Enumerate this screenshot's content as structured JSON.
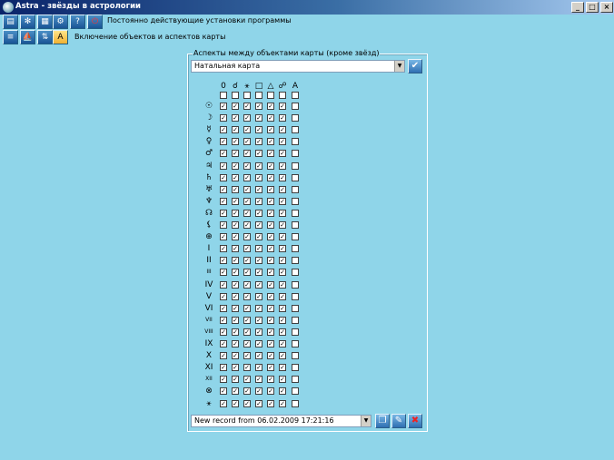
{
  "window": {
    "title": "Astra - звёзды в астрологии",
    "controls": [
      "_",
      "□",
      "×"
    ]
  },
  "toolbar": {
    "row1_label": "Постоянно действующие установки программы",
    "row2_label": "Включение объектов и аспектов карты",
    "row1_icons": [
      "document-icon",
      "asterisk-icon",
      "grid-icon",
      "gear-icon",
      "help-icon",
      "power-icon"
    ],
    "row2_icons": [
      "list-icon",
      "ship-icon",
      "compare-icon",
      "font-icon"
    ]
  },
  "aspects_panel": {
    "title": "Аспекты между объектами карты (кроме звёзд)",
    "chart_type": "Натальная карта",
    "record": "New record from 06.02.2009 17:21:16",
    "columns": [
      "0",
      "☌",
      "⚹",
      "□",
      "△",
      "☍",
      "A"
    ],
    "rows": [
      {
        "symbol": "☉",
        "checked": [
          true,
          true,
          true,
          true,
          true,
          true,
          false
        ]
      },
      {
        "symbol": "☽",
        "checked": [
          true,
          true,
          true,
          true,
          true,
          true,
          false
        ]
      },
      {
        "symbol": "☿",
        "checked": [
          true,
          true,
          true,
          true,
          true,
          true,
          false
        ]
      },
      {
        "symbol": "♀",
        "checked": [
          true,
          true,
          true,
          true,
          true,
          true,
          false
        ]
      },
      {
        "symbol": "♂",
        "checked": [
          true,
          true,
          true,
          true,
          true,
          true,
          false
        ]
      },
      {
        "symbol": "♃",
        "checked": [
          true,
          true,
          true,
          true,
          true,
          true,
          false
        ]
      },
      {
        "symbol": "♄",
        "checked": [
          true,
          true,
          true,
          true,
          true,
          true,
          false
        ]
      },
      {
        "symbol": "♅",
        "checked": [
          true,
          true,
          true,
          true,
          true,
          true,
          false
        ]
      },
      {
        "symbol": "♆",
        "checked": [
          true,
          true,
          true,
          true,
          true,
          true,
          false
        ]
      },
      {
        "symbol": "☊",
        "checked": [
          true,
          true,
          true,
          true,
          true,
          true,
          false
        ]
      },
      {
        "symbol": "⚸",
        "checked": [
          true,
          true,
          true,
          true,
          true,
          true,
          false
        ]
      },
      {
        "symbol": "⊕",
        "checked": [
          true,
          true,
          true,
          true,
          true,
          true,
          false
        ]
      },
      {
        "symbol": "I",
        "checked": [
          true,
          true,
          true,
          true,
          true,
          true,
          false
        ]
      },
      {
        "symbol": "II",
        "checked": [
          true,
          true,
          true,
          true,
          true,
          true,
          false
        ]
      },
      {
        "symbol": "III",
        "checked": [
          true,
          true,
          true,
          true,
          true,
          true,
          false
        ]
      },
      {
        "symbol": "IV",
        "checked": [
          true,
          true,
          true,
          true,
          true,
          true,
          false
        ]
      },
      {
        "symbol": "V",
        "checked": [
          true,
          true,
          true,
          true,
          true,
          true,
          false
        ]
      },
      {
        "symbol": "VI",
        "checked": [
          true,
          true,
          true,
          true,
          true,
          true,
          false
        ]
      },
      {
        "symbol": "VII",
        "checked": [
          true,
          true,
          true,
          true,
          true,
          true,
          false
        ]
      },
      {
        "symbol": "VIII",
        "checked": [
          true,
          true,
          true,
          true,
          true,
          true,
          false
        ]
      },
      {
        "symbol": "IX",
        "checked": [
          true,
          true,
          true,
          true,
          true,
          true,
          false
        ]
      },
      {
        "symbol": "X",
        "checked": [
          true,
          true,
          true,
          true,
          true,
          true,
          false
        ]
      },
      {
        "symbol": "XI",
        "checked": [
          true,
          true,
          true,
          true,
          true,
          true,
          false
        ]
      },
      {
        "symbol": "XII",
        "checked": [
          true,
          true,
          true,
          true,
          true,
          true,
          false
        ]
      },
      {
        "symbol": "⊗",
        "checked": [
          true,
          true,
          true,
          true,
          true,
          true,
          false
        ]
      },
      {
        "symbol": "⚹",
        "checked": [
          true,
          true,
          true,
          true,
          true,
          true,
          false
        ]
      }
    ]
  }
}
